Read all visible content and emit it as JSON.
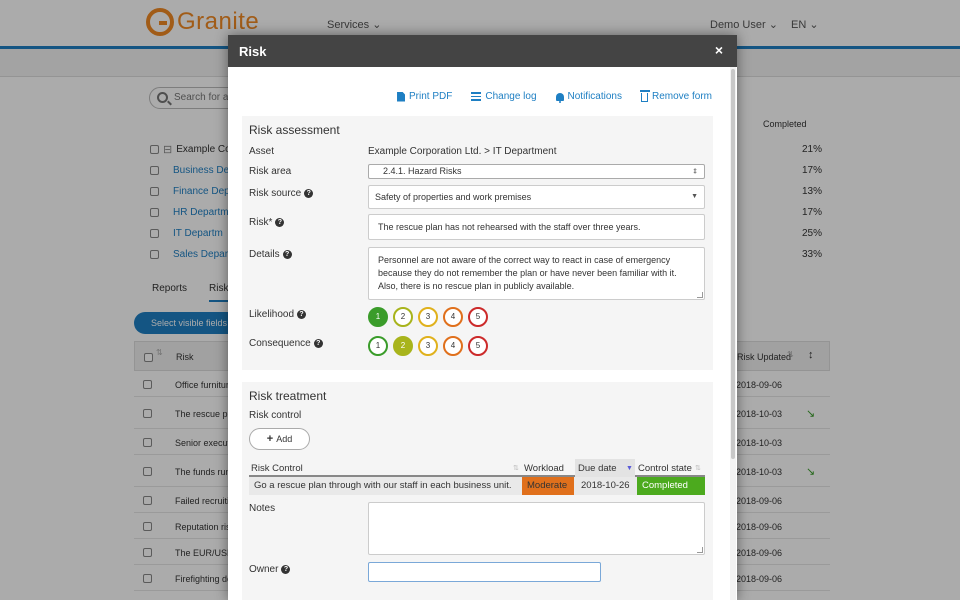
{
  "app": {
    "brand": "Granite",
    "nav": {
      "services": "Services",
      "user": "Demo User",
      "lang": "EN"
    },
    "search_placeholder": "Search for as",
    "completed_header": "Completed",
    "tree": [
      {
        "label": "Example Co",
        "pct": "21%"
      },
      {
        "label": "Business De",
        "pct": "17%"
      },
      {
        "label": "Finance Dep",
        "pct": "13%"
      },
      {
        "label": "HR Departm",
        "pct": "17%"
      },
      {
        "label": "IT Departm",
        "pct": "25%"
      },
      {
        "label": "Sales Depart",
        "pct": "33%"
      }
    ],
    "tabs": {
      "reports": "Reports",
      "risks": "Risk"
    },
    "select_visible_fields": "Select visible fields",
    "grid": {
      "col_risk": "Risk",
      "col_updated": "Risk Updated",
      "rows": [
        {
          "risk": "Office furnitur",
          "updated": "2018-09-06",
          "arrow": ""
        },
        {
          "risk": "The rescue pla",
          "updated": "2018-10-03",
          "arrow": "↘"
        },
        {
          "risk": "Senior executi",
          "updated": "2018-10-03",
          "arrow": ""
        },
        {
          "risk": "The funds run",
          "updated": "2018-10-03",
          "arrow": "↘"
        },
        {
          "risk": "Failed recruitin",
          "updated": "2018-09-06",
          "arrow": ""
        },
        {
          "risk": "Reputation risk",
          "updated": "2018-09-06",
          "arrow": ""
        },
        {
          "risk": "The EUR/USD",
          "updated": "2018-09-06",
          "arrow": ""
        },
        {
          "risk": "Firefighting de",
          "updated": "2018-09-06",
          "arrow": ""
        }
      ]
    }
  },
  "modal": {
    "title": "Risk",
    "close": "×",
    "actions": {
      "print_pdf": "Print PDF",
      "change_log": "Change log",
      "notifications": "Notifications",
      "remove_form": "Remove form"
    },
    "assessment": {
      "title": "Risk assessment",
      "asset_label": "Asset",
      "asset_value": "Example Corporation Ltd. > IT Department",
      "area_label": "Risk area",
      "area_value": "2.4.1. Hazard Risks",
      "source_label": "Risk source",
      "source_value": "Safety of properties and work premises",
      "risk_label": "Risk*",
      "risk_value": "The rescue plan has not rehearsed with the staff over three years.",
      "details_label": "Details",
      "details_value": "Personnel are not aware of the correct way to react in case of emergency because they do not remember the plan or have never been familiar with it. Also, there is no rescue plan in publicly available.",
      "likelihood_label": "Likelihood",
      "likelihood_selected": 1,
      "consequence_label": "Consequence",
      "consequence_selected": 2,
      "scale": [
        "1",
        "2",
        "3",
        "4",
        "5"
      ]
    },
    "treatment": {
      "title": "Risk treatment",
      "control_label": "Risk control",
      "add_button": "Add",
      "table": {
        "headers": {
          "control": "Risk Control",
          "workload": "Workload",
          "due": "Due date",
          "state": "Control state"
        },
        "row": {
          "control": "Go a rescue plan through with our staff in each business unit.",
          "workload": "Moderate",
          "due": "2018-10-26",
          "state": "Completed"
        }
      },
      "notes_label": "Notes",
      "notes_value": "",
      "owner_label": "Owner",
      "owner_value": ""
    }
  },
  "colors": {
    "brand_orange": "#f08a24",
    "accent_blue": "#1e7fc3",
    "workload_moderate": "#e0701c",
    "state_completed": "#4caa1e",
    "scale_colors": [
      "#3a9c2a",
      "#a8b41c",
      "#e0b11c",
      "#e0701c",
      "#cc2a2a"
    ]
  }
}
